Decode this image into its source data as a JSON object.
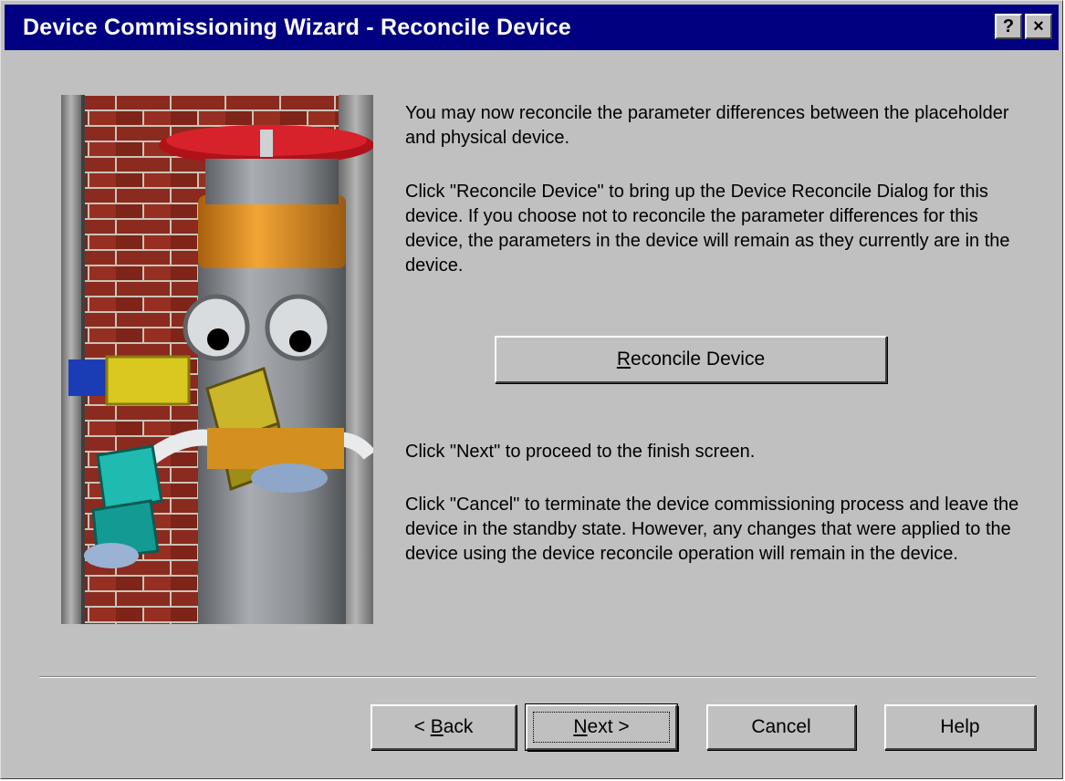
{
  "window": {
    "title": "Device Commissioning Wizard - Reconcile Device",
    "help_button_glyph": "?",
    "close_button_glyph": "×"
  },
  "illustration": {
    "description_icon": "pipe-mascot-illustration"
  },
  "content": {
    "paragraph1": "You may now reconcile the parameter differences between the placeholder and physical device.",
    "paragraph2": "Click \"Reconcile Device\" to bring up the Device Reconcile Dialog for this device. If you choose not to reconcile the parameter differences for this device, the parameters in the device will remain as they currently are in the device.",
    "paragraph3": "Click \"Next\" to proceed to the finish screen.",
    "paragraph4": "Click \"Cancel\" to terminate the device commissioning process and leave the device in the standby state. However, any changes that were applied to the device using the device reconcile operation will remain in the device."
  },
  "reconcile_button": {
    "mnemonic": "R",
    "label_rest": "econcile Device"
  },
  "footer": {
    "back_prefix": "< ",
    "back_mnemonic": "B",
    "back_rest": "ack",
    "next_mnemonic": "N",
    "next_rest": "ext >",
    "cancel_label": "Cancel",
    "help_label": "Help"
  },
  "colors": {
    "titlebar": "#000080",
    "dialog_face": "#c0c0c0",
    "brick": "#8b2a1e",
    "valve_red": "#c8161e",
    "cap_orange": "#e08a1a",
    "pipe_gray": "#8e9296"
  }
}
